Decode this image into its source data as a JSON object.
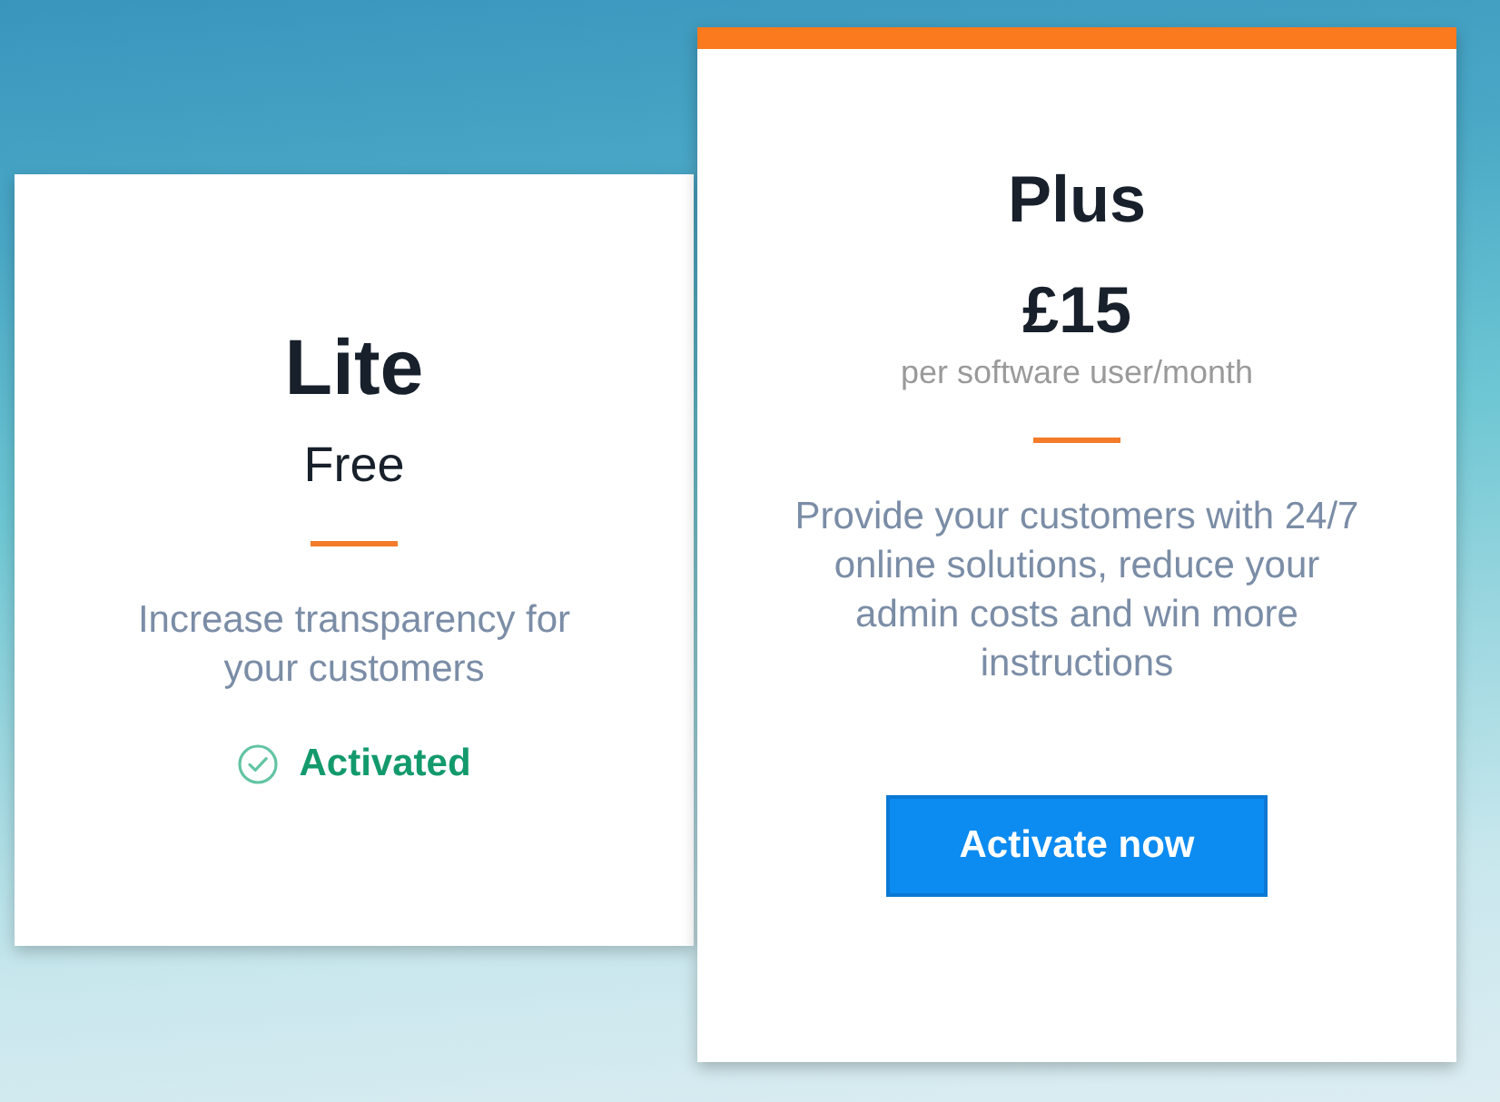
{
  "plans": [
    {
      "name": "Lite",
      "price": "Free",
      "featured": false,
      "description": "Increase transparency for your customers",
      "footer": {
        "kind": "status",
        "label": "Activated"
      }
    },
    {
      "name": "Plus",
      "price": "£15",
      "price_note": "per software user/month",
      "featured": true,
      "description": "Provide your customers with 24/7 online solutions, reduce your admin costs and win more instructions",
      "footer": {
        "kind": "button",
        "label": "Activate now"
      }
    }
  ]
}
